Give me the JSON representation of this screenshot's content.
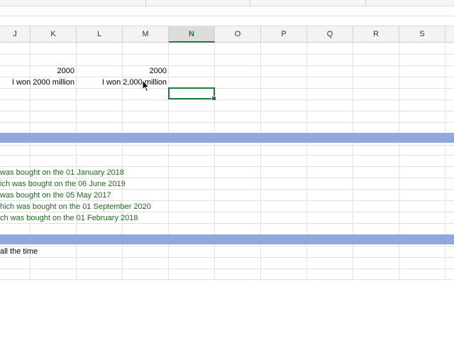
{
  "columns": [
    {
      "label": "J"
    },
    {
      "label": "K"
    },
    {
      "label": "L"
    },
    {
      "label": "M"
    },
    {
      "label": "N"
    },
    {
      "label": "O"
    },
    {
      "label": "P"
    },
    {
      "label": "Q"
    },
    {
      "label": "R"
    },
    {
      "label": "S"
    }
  ],
  "active_column": "N",
  "cells": {
    "k_value": "2000",
    "m_value": "2000",
    "j_text": "I won 2000 million",
    "l_text": "I won 2,000 million"
  },
  "list_items": [
    "was bought on the 01 January 2018",
    "ich was bought on the 06 June 2019",
    "was bought on the 05 May 2017",
    "hich was bought on the 01 September 2020",
    "ch was bought on the 01 February 2018"
  ],
  "bottom_text": "all the time",
  "colors": {
    "accent_green": "#1f7a3b",
    "band_blue": "#8fa9dc",
    "text_green": "#1e6b1e"
  },
  "icons": {
    "cursor": "mouse-pointer-icon"
  }
}
